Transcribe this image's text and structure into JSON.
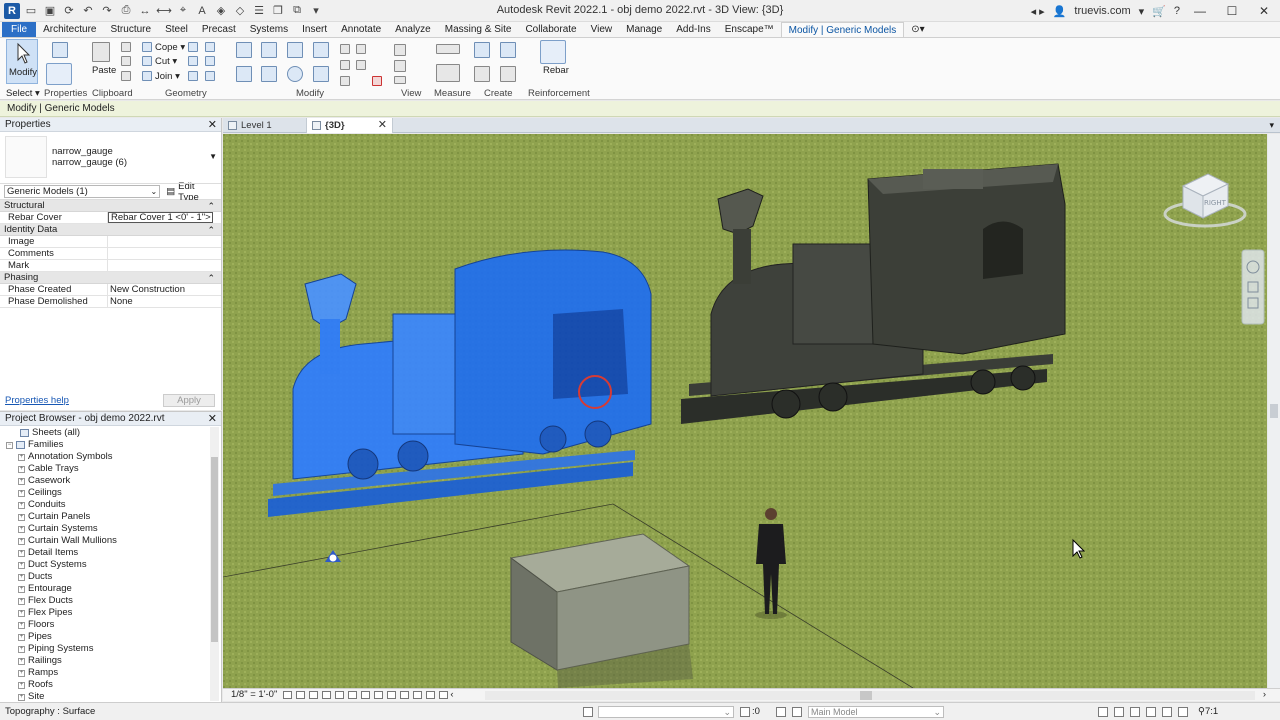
{
  "app": {
    "title": "Autodesk Revit 2022.1 - obj demo 2022.rvt - 3D View: {3D}",
    "user": "truevis.com"
  },
  "tabs": [
    {
      "label": "File"
    },
    {
      "label": "Architecture"
    },
    {
      "label": "Structure"
    },
    {
      "label": "Steel"
    },
    {
      "label": "Precast"
    },
    {
      "label": "Systems"
    },
    {
      "label": "Insert"
    },
    {
      "label": "Annotate"
    },
    {
      "label": "Analyze"
    },
    {
      "label": "Massing & Site"
    },
    {
      "label": "Collaborate"
    },
    {
      "label": "View"
    },
    {
      "label": "Manage"
    },
    {
      "label": "Add-Ins"
    },
    {
      "label": "Enscape™"
    },
    {
      "label": "Modify | Generic Models"
    }
  ],
  "ribbon": {
    "modify": "Modify",
    "paste": "Paste",
    "cope": "Cope",
    "cut": "Cut",
    "join": "Join",
    "rebar": "Rebar",
    "panels": {
      "select": "Select",
      "properties": "Properties",
      "clipboard": "Clipboard",
      "geometry": "Geometry",
      "modify": "Modify",
      "view": "View",
      "measure": "Measure",
      "create": "Create",
      "reinforcement": "Reinforcement"
    }
  },
  "context": "Modify | Generic Models",
  "properties": {
    "title": "Properties",
    "type_line1": "narrow_gauge",
    "type_line2": "narrow_gauge (6)",
    "instance_filter": "Generic Models (1)",
    "edit_type": "Edit Type",
    "groups": {
      "structural": "Structural",
      "identity": "Identity Data",
      "phasing": "Phasing"
    },
    "rows": {
      "rebar_cover_k": "Rebar Cover",
      "rebar_cover_v": "Rebar Cover 1 <0' - 1\">",
      "image_k": "Image",
      "comments_k": "Comments",
      "mark_k": "Mark",
      "phase_created_k": "Phase Created",
      "phase_created_v": "New Construction",
      "phase_demolished_k": "Phase Demolished",
      "phase_demolished_v": "None"
    },
    "help": "Properties help",
    "apply": "Apply"
  },
  "browser": {
    "title": "Project Browser - obj demo 2022.rvt",
    "sheets": "Sheets (all)",
    "families": "Families",
    "items": [
      "Annotation Symbols",
      "Cable Trays",
      "Casework",
      "Ceilings",
      "Conduits",
      "Curtain Panels",
      "Curtain Systems",
      "Curtain Wall Mullions",
      "Detail Items",
      "Duct Systems",
      "Ducts",
      "Entourage",
      "Flex Ducts",
      "Flex Pipes",
      "Floors",
      "Pipes",
      "Piping Systems",
      "Railings",
      "Ramps",
      "Roofs",
      "Site"
    ]
  },
  "viewtabs": [
    {
      "label": "Level 1"
    },
    {
      "label": "{3D}"
    }
  ],
  "viewcube": {
    "face": "RIGHT"
  },
  "viewcontrol": {
    "scale": "1/8\" = 1'-0\""
  },
  "status": {
    "text": "Topography : Surface",
    "model": "Main Model",
    "zero": ":0",
    "filter": "7:1"
  },
  "colors": {
    "selection": "#2e7dff",
    "accent": "#2c6fc6",
    "grass": "#8fa24e"
  }
}
